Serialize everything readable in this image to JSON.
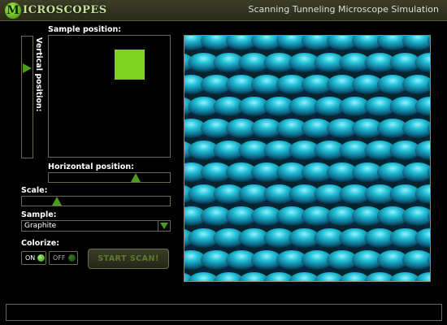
{
  "header": {
    "logo_letter": "M",
    "logo_text": "ICROSCOPES",
    "title": "Scanning Tunneling Microscope Simulation"
  },
  "controls": {
    "vertical_label": "Vertical position:",
    "vertical_value": 0.76,
    "sample_label": "Sample position:",
    "horizontal_label": "Horizontal position:",
    "horizontal_value": 0.74,
    "scale_label": "Scale:",
    "scale_value": 0.22,
    "sample_select_label": "Sample:",
    "sample_select_value": "Graphite",
    "colorize_label": "Colorize:",
    "on_label": "ON",
    "off_label": "OFF",
    "start_button": "START SCAN!"
  },
  "colors": {
    "accent": "#7ed321",
    "thumb": "#4c9a1c",
    "on_dot": "#4fbf2a",
    "off_dot": "#1f5a12",
    "scan_base": "#06242e",
    "scan_peak": "#27c8dc"
  },
  "status_text": ""
}
